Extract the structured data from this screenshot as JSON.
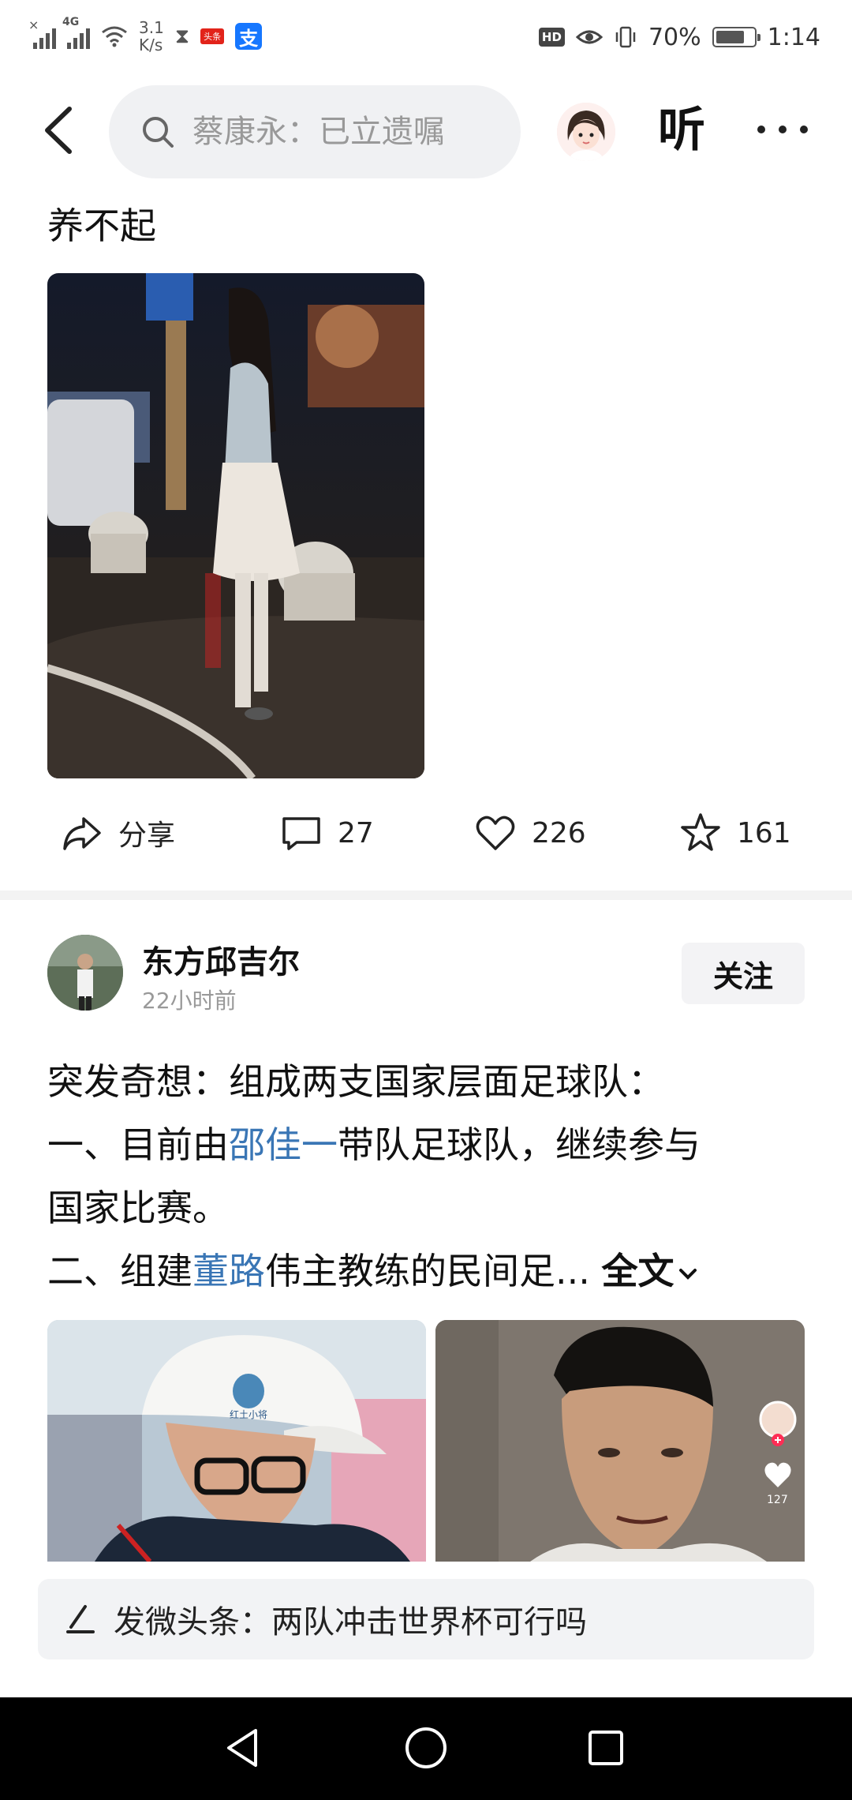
{
  "status_bar": {
    "network_speed_value": "3.1",
    "network_speed_unit": "K/s",
    "network_type": "4G",
    "app_badge": "头条",
    "alipay_glyph": "支",
    "hd_badge": "HD",
    "battery_level": 0.7,
    "battery_text": "70%",
    "time": "1:14"
  },
  "topbar": {
    "search_placeholder": "蔡康永：已立遗嘱",
    "listen_label": "听"
  },
  "post1": {
    "text": "养不起",
    "actions": {
      "share_label": "分享",
      "comments": "27",
      "likes": "226",
      "favorites": "161"
    }
  },
  "post2": {
    "author": "东方邱吉尔",
    "time": "22小时前",
    "follow_label": "关注",
    "line1": "突发奇想：组成两支国家层面足球队：",
    "line2_pre": "一、目前由",
    "line2_link": "邵佳一",
    "line2_post": "带队足球队，继续参与",
    "line3": "国家比赛。",
    "line4_pre": "二、组建",
    "line4_link": "董路",
    "line4_post": "伟主教练的民间足...",
    "expand_label": "全文",
    "right_image_likes": "127",
    "cap_logo_text": "红土小将"
  },
  "compose": {
    "text": "发微头条：两队冲击世界杯可行吗"
  },
  "colors": {
    "link": "#3a76b5",
    "background": "#ffffff",
    "search_bg": "#f0f1f3"
  }
}
